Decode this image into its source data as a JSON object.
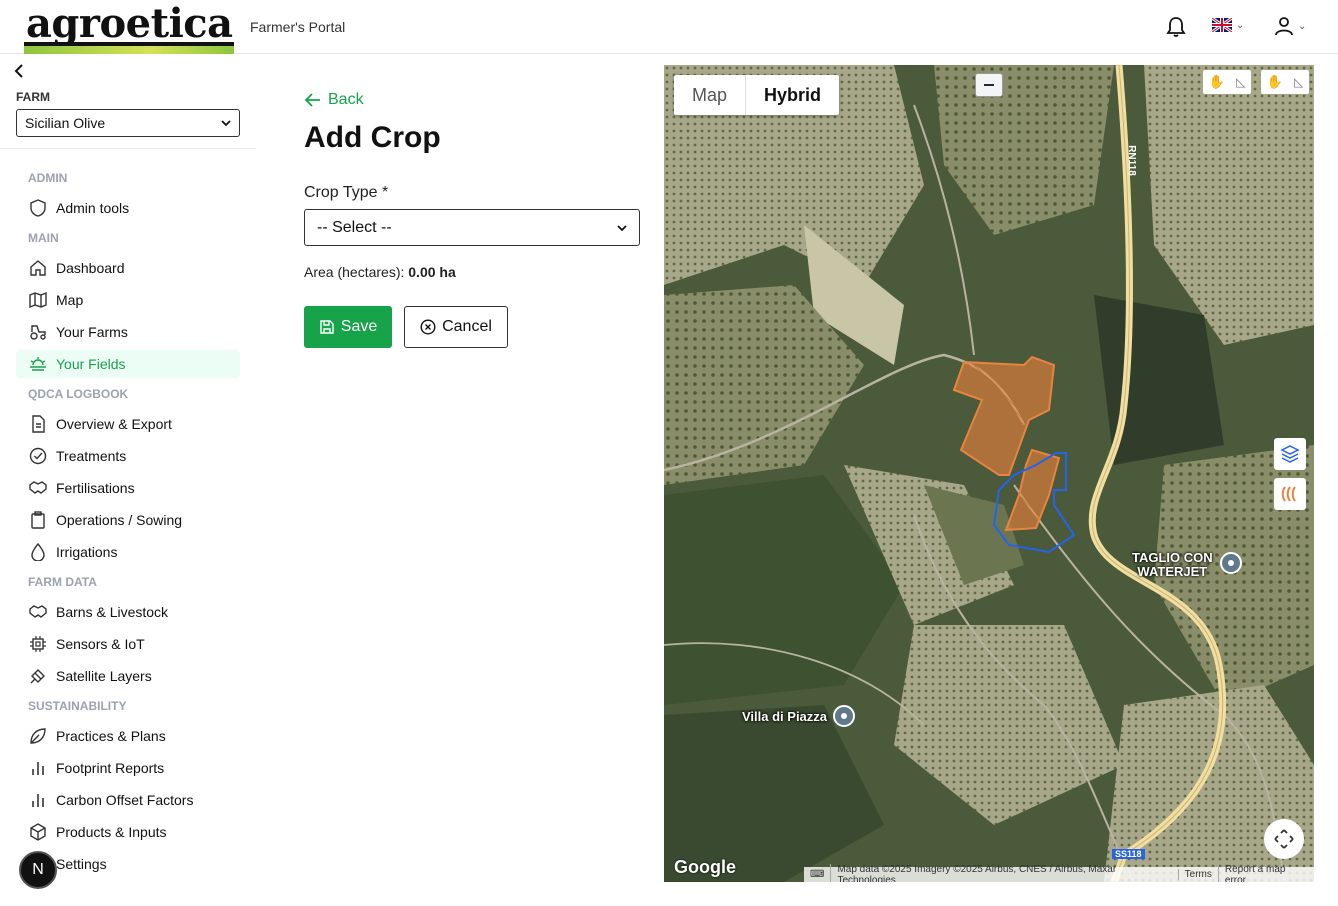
{
  "header": {
    "logo_text": "agroetica",
    "portal_label": "Farmer's Portal",
    "icons": [
      "bell-icon",
      "uk-flag-icon",
      "user-icon"
    ]
  },
  "sidebar": {
    "farm_label": "FARM",
    "farm_value": "Sicilian Olive",
    "sections": {
      "admin": "ADMIN",
      "main": "MAIN",
      "qdca": "QDCA LOGBOOK",
      "farm_data": "FARM DATA",
      "sustainability": "SUSTAINABILITY"
    },
    "items": {
      "admin_tools": "Admin tools",
      "dashboard": "Dashboard",
      "map": "Map",
      "your_farms": "Your Farms",
      "your_fields": "Your Fields",
      "overview_export": "Overview & Export",
      "treatments": "Treatments",
      "fertilisations": "Fertilisations",
      "operations_sowing": "Operations / Sowing",
      "irrigations": "Irrigations",
      "barns_livestock": "Barns & Livestock",
      "sensors_iot": "Sensors & IoT",
      "satellite_layers": "Satellite Layers",
      "practices_plans": "Practices & Plans",
      "footprint_reports": "Footprint Reports",
      "carbon_offset": "Carbon Offset Factors",
      "products_inputs": "Products & Inputs",
      "settings": "Settings"
    },
    "badge": "N"
  },
  "form": {
    "back_label": "Back",
    "title": "Add Crop",
    "crop_type_label": "Crop Type *",
    "crop_type_value": "-- Select --",
    "area_label": "Area (hectares):",
    "area_value": "0.00 ha",
    "save_label": "Save",
    "cancel_label": "Cancel"
  },
  "map": {
    "tab_map": "Map",
    "tab_hybrid": "Hybrid",
    "active_tab": "Hybrid",
    "places": {
      "taglio_line1": "TAGLIO CON",
      "taglio_line2": "WATERJET",
      "villa": "Villa di Piazza"
    },
    "roads": {
      "rn": "RN118",
      "ss": "SS118"
    },
    "google": "Google",
    "attribution": {
      "data": "Map data ©2025 Imagery ©2025 Airbus, CNES / Airbus, Maxar Technologies",
      "terms": "Terms",
      "report": "Report a map error"
    },
    "colors": {
      "field_fill": "#e8843f",
      "field_outline": "#2563eb",
      "road": "#f2dfa0"
    }
  }
}
